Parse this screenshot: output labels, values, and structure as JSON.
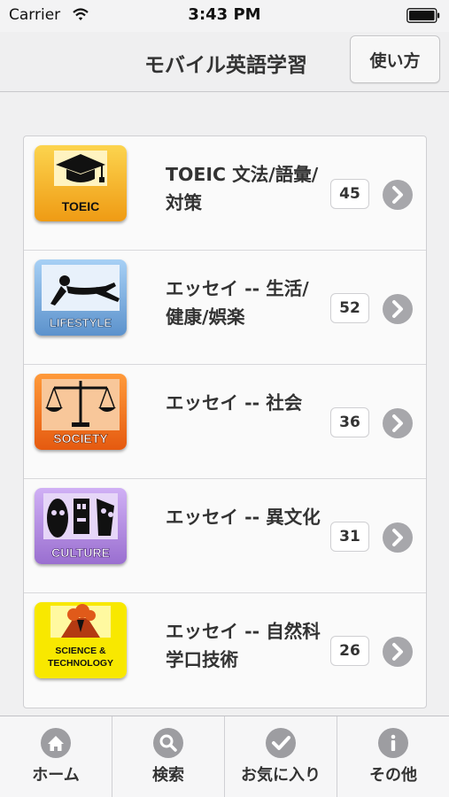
{
  "status_bar": {
    "carrier": "Carrier",
    "time": "3:43 PM"
  },
  "nav": {
    "title": "モバイル英語学習",
    "help_button": "使い方"
  },
  "list": {
    "items": [
      {
        "title": "TOEIC 文法/語彙/対策",
        "count": "45",
        "badge": "TOEIC",
        "icon": "graduation-cap-icon",
        "color": "#f5b52a"
      },
      {
        "title": "エッセイ -- 生活/健康/娯楽",
        "count": "52",
        "badge": "LIFESTYLE",
        "icon": "relaxing-person-icon",
        "color": "#7fb2e0"
      },
      {
        "title": "エッセイ -- 社会",
        "count": "36",
        "badge": "SOCIETY",
        "icon": "scales-icon",
        "color": "#f36d1d"
      },
      {
        "title": "エッセイ -- 異文化",
        "count": "31",
        "badge": "CULTURE",
        "icon": "masks-icon",
        "color": "#b58de0"
      },
      {
        "title": "エッセイ -- 自然科学口技術",
        "count": "26",
        "badge": "SCIENCE & TECHNOLOGY",
        "icon": "volcano-icon",
        "color": "#f8e800"
      }
    ]
  },
  "tabs": [
    {
      "label": "ホーム",
      "icon": "home-icon"
    },
    {
      "label": "検索",
      "icon": "search-icon"
    },
    {
      "label": "お気に入り",
      "icon": "checkmark-icon"
    },
    {
      "label": "その他",
      "icon": "info-icon"
    }
  ]
}
